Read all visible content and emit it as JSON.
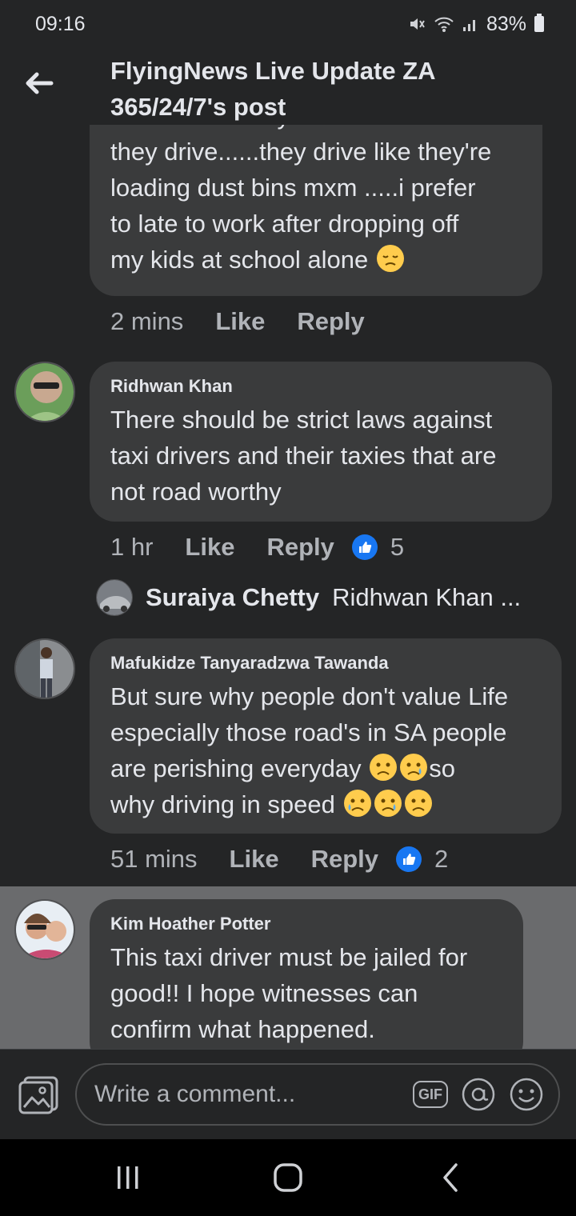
{
  "status_bar": {
    "time": "09:16",
    "battery": "83%"
  },
  "header": {
    "title": "FlyingNews Live Update ZA 365/24/7's post"
  },
  "comments": [
    {
      "lines": [
        "Taxi drivers they don't care how",
        "they drive......they drive like they're",
        "loading dust bins mxm .....i prefer",
        "to late to work after dropping off",
        "my kids at school alone"
      ],
      "emoji": "downcast-face",
      "time": "2 mins",
      "like": "Like",
      "reply": "Reply"
    },
    {
      "author": "Ridhwan Khan",
      "text": "There should be strict laws against taxi drivers and their taxies that are not road worthy",
      "time": "1 hr",
      "like": "Like",
      "reply": "Reply",
      "reactions": "5",
      "reply_preview": {
        "author": "Suraiya Chetty",
        "snippet": "Ridhwan Khan ..."
      }
    },
    {
      "author": "Mafukidze Tanyaradzwa Tawanda",
      "line1": "But sure why people don't value Life",
      "line2": "especially those road's in SA people",
      "line3a": "are perishing everyday",
      "line3b": "so",
      "line4": "why driving in speed",
      "time": "51 mins",
      "like": "Like",
      "reply": "Reply",
      "reactions": "2"
    },
    {
      "author": "Kim Hoather Potter",
      "text": "This taxi driver must be jailed for good!! I hope witnesses can confirm what happened."
    }
  ],
  "composer": {
    "placeholder": "Write a comment...",
    "gif_label": "GIF"
  },
  "colors": {
    "background": "#242526",
    "bubble": "#3a3b3c",
    "accent": "#1877f2",
    "highlight": "#6a6b6d"
  }
}
